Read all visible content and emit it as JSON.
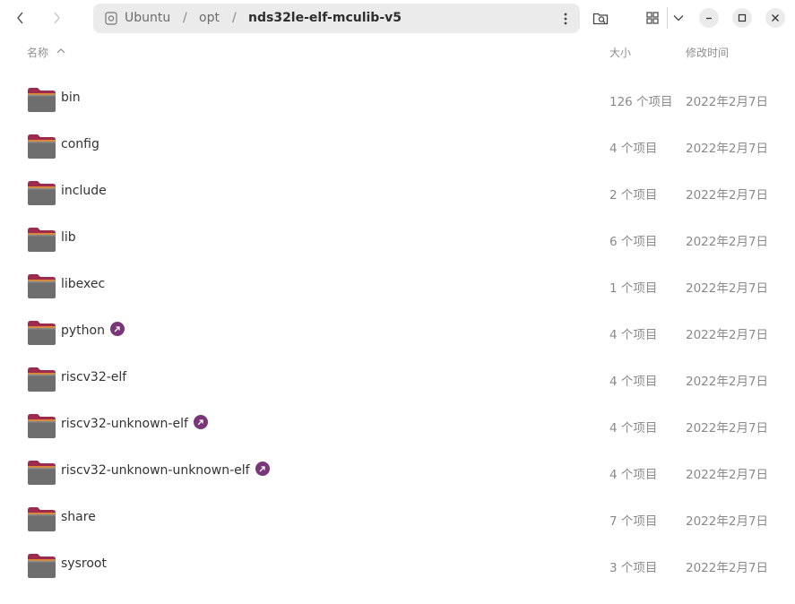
{
  "path": {
    "crumbs": [
      "Ubuntu",
      "opt",
      "nds32le-elf-mculib-v5"
    ],
    "separator": "/"
  },
  "columns": {
    "name": "名称",
    "size": "大小",
    "modified": "修改时间"
  },
  "icons": {
    "back": "chevron-left-icon",
    "forward": "chevron-right-icon",
    "drive": "disk-icon",
    "path_menu": "vertical-dots-icon",
    "search": "folder-search-icon",
    "view": "grid-view-icon",
    "view_options": "chevron-down-icon",
    "minimize": "minimize-icon",
    "maximize": "maximize-icon",
    "close": "close-icon",
    "sort": "sort-ascending-icon",
    "folder": "folder-icon",
    "symlink": "symlink-arrow-icon"
  },
  "colors": {
    "folder_body": "#6e6e6e",
    "folder_tab": "#9c2b4e",
    "symlink_badge": "#7a3579",
    "pathbar_bg": "#ebebeb"
  },
  "files": [
    {
      "name": "bin",
      "size": "126 个项目",
      "modified": "2022年2月7日",
      "symlink": false
    },
    {
      "name": "config",
      "size": "4 个项目",
      "modified": "2022年2月7日",
      "symlink": false
    },
    {
      "name": "include",
      "size": "2 个项目",
      "modified": "2022年2月7日",
      "symlink": false
    },
    {
      "name": "lib",
      "size": "6 个项目",
      "modified": "2022年2月7日",
      "symlink": false
    },
    {
      "name": "libexec",
      "size": "1 个项目",
      "modified": "2022年2月7日",
      "symlink": false
    },
    {
      "name": "python",
      "size": "4 个项目",
      "modified": "2022年2月7日",
      "symlink": true
    },
    {
      "name": "riscv32-elf",
      "size": "4 个项目",
      "modified": "2022年2月7日",
      "symlink": false
    },
    {
      "name": "riscv32-unknown-elf",
      "size": "4 个项目",
      "modified": "2022年2月7日",
      "symlink": true
    },
    {
      "name": "riscv32-unknown-unknown-elf",
      "size": "4 个项目",
      "modified": "2022年2月7日",
      "symlink": true
    },
    {
      "name": "share",
      "size": "7 个项目",
      "modified": "2022年2月7日",
      "symlink": false
    },
    {
      "name": "sysroot",
      "size": "3 个项目",
      "modified": "2022年2月7日",
      "symlink": false
    }
  ]
}
